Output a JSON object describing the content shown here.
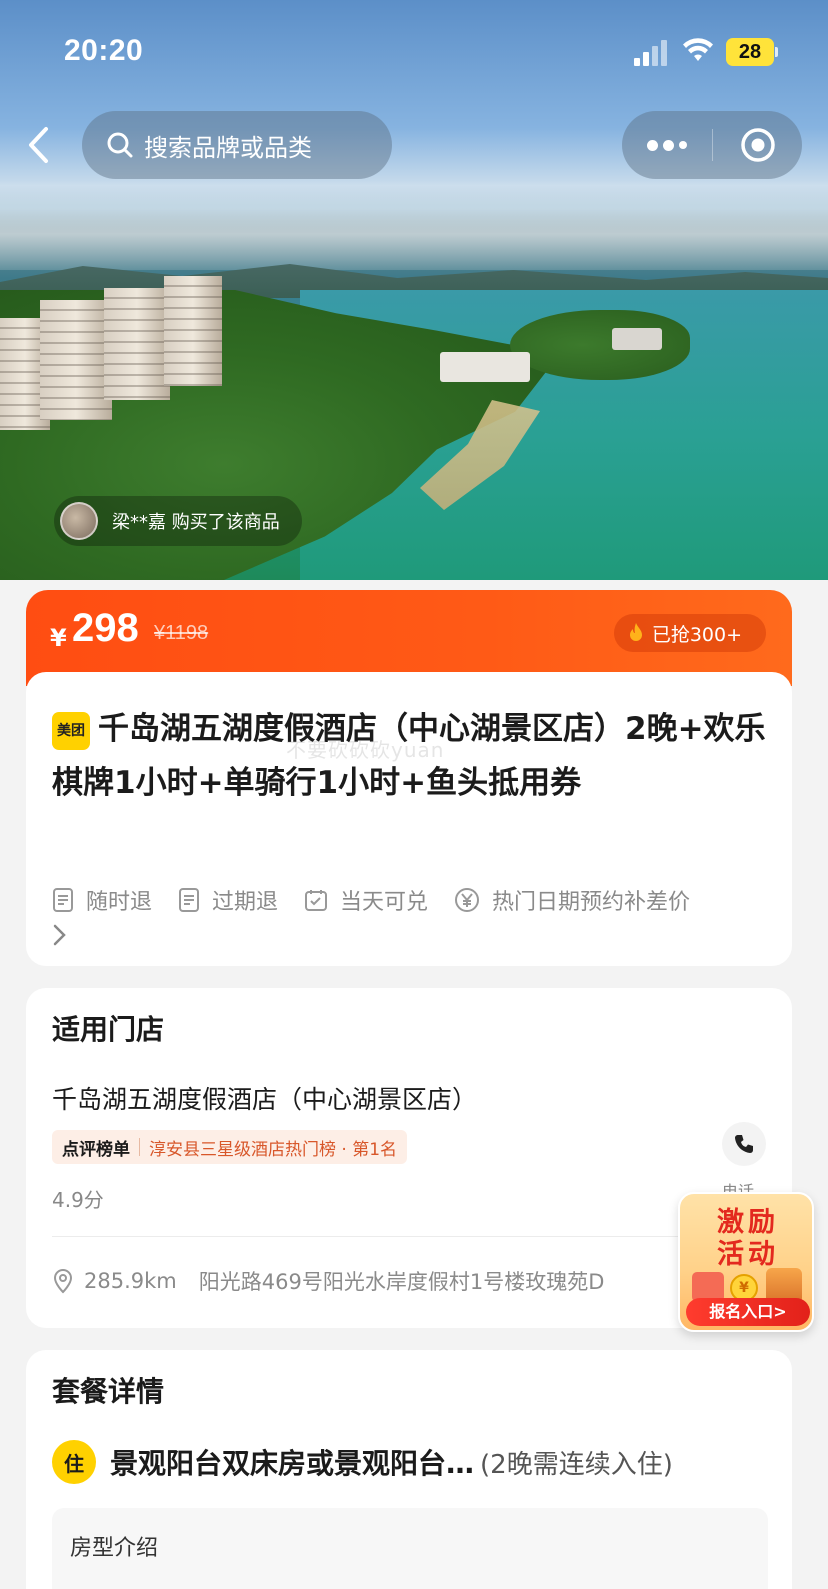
{
  "status_bar": {
    "time": "20:20",
    "battery": "28"
  },
  "nav": {
    "search_placeholder": "搜索品牌或品类"
  },
  "buyer_ticker": {
    "text": "梁**嘉 购买了该商品"
  },
  "price": {
    "currency": "¥",
    "current": "298",
    "original": "¥1198",
    "sold": "已抢300+"
  },
  "product": {
    "brand_badge": "美团",
    "title": "千岛湖五湖度假酒店（中心湖景区店）2晚+欢乐棋牌1小时+单骑行1小时+鱼头抵用券",
    "tags": [
      "随时退",
      "过期退",
      "当天可兑",
      "热门日期预约补差价"
    ]
  },
  "watermark": "不要砍砍砍yuan",
  "store": {
    "section_title": "适用门店",
    "name": "千岛湖五湖度假酒店（中心湖景区店）",
    "rank_logo": "点评榜单",
    "rank_text": "淳安县三星级酒店热门榜 · 第1名",
    "score": "4.9分",
    "call_label": "电话",
    "distance": "285.9km",
    "address": "阳光路469号阳光水岸度假村1号楼玫瑰苑D"
  },
  "promo": {
    "line1": "激励",
    "line2": "活动",
    "cta": "报名入口>",
    "coin": "¥"
  },
  "package": {
    "section_title": "套餐详情",
    "stay_badge": "住",
    "room_name": "景观阳台双床房或景观阳台…",
    "room_note": "(2晚需连续入住)",
    "room_intro_label": "房型介绍"
  },
  "colors": {
    "accent": "#ff4d12",
    "brand_yellow": "#ffd100",
    "rank_red": "#d8572a"
  },
  "icons": [
    "back-arrow-icon",
    "search-icon",
    "more-icon",
    "target-icon",
    "fire-icon",
    "refund-icon",
    "calendar-check-icon",
    "yen-circle-icon",
    "chevron-right-icon",
    "phone-icon",
    "location-icon"
  ]
}
